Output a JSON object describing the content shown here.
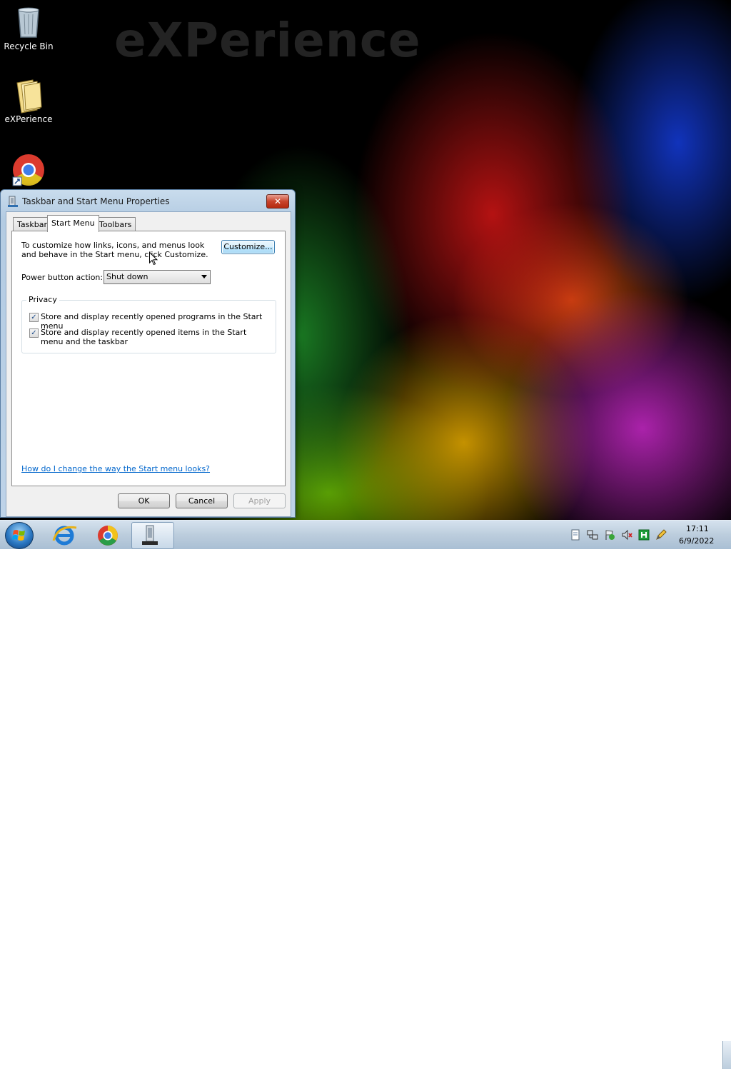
{
  "desktop": {
    "watermark": "eXPerience",
    "icons": [
      {
        "label": "Recycle Bin",
        "icon": "recycle-bin-icon"
      },
      {
        "label": "eXPerience",
        "icon": "folder-icon"
      },
      {
        "label": "",
        "icon": "chrome-shortcut-icon"
      }
    ]
  },
  "dialog": {
    "title": "Taskbar and Start Menu Properties",
    "close_label": "✕",
    "tabs": [
      {
        "label": "Taskbar",
        "active": false
      },
      {
        "label": "Start Menu",
        "active": true
      },
      {
        "label": "Toolbars",
        "active": false
      }
    ],
    "intro": "To customize how links, icons, and menus look and behave in the Start menu, click Customize.",
    "customize_label": "Customize...",
    "power_label": "Power button action:",
    "power_value": "Shut down",
    "privacy": {
      "legend": "Privacy",
      "items": [
        {
          "label": "Store and display recently opened programs in the Start menu",
          "checked": true
        },
        {
          "label": "Store and display recently opened items in the Start menu and the taskbar",
          "checked": true
        }
      ]
    },
    "help_link": "How do I change the way the Start menu looks?",
    "buttons": {
      "ok": "OK",
      "cancel": "Cancel",
      "apply": "Apply"
    }
  },
  "taskbar": {
    "items": [
      {
        "name": "internet-explorer",
        "icon": "ie-icon"
      },
      {
        "name": "chrome",
        "icon": "chrome-icon"
      },
      {
        "name": "taskbar-properties",
        "icon": "taskbar-properties-icon",
        "active": true
      }
    ],
    "clock": {
      "time": "17:11",
      "date": "6/9/2022"
    }
  },
  "colors": {
    "accent": "#3c7fb1",
    "link": "#0066cc",
    "close": "#c8432b"
  }
}
